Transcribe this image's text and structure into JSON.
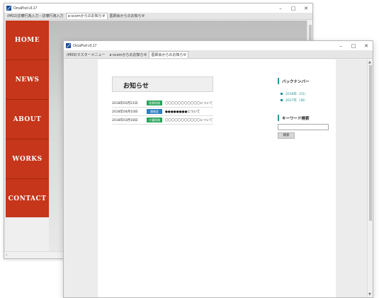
{
  "back_window": {
    "title": "OrcaPod v3.17",
    "controls": [
      "–",
      "□",
      "✕"
    ],
    "tabs": [
      {
        "label": "(M02)診療行為入力－診療行為入力",
        "active": false
      },
      {
        "label": "a-scomからのお知らせ",
        "active": true
      },
      {
        "label": "医師会からのお知らせ",
        "active": false
      }
    ],
    "nav_items": [
      "HOME",
      "NEWS",
      "ABOUT",
      "WORKS",
      "CONTACT"
    ],
    "colors": {
      "nav": "#c6361a"
    }
  },
  "front_window": {
    "title": "OrcaPod v3.17",
    "controls": [
      "–",
      "□",
      "✕"
    ],
    "tabs": [
      {
        "label": "(M00)マスターメニュー",
        "active": false
      },
      {
        "label": "a-scomからのお知らせ",
        "active": false
      },
      {
        "label": "医師会からのお知らせ",
        "active": true
      }
    ],
    "heading": "お知らせ",
    "news": [
      {
        "date": "2018年05月21日",
        "category": "医療保険",
        "category_color": "#27a35a",
        "text": "〇〇〇〇〇〇〇〇〇〇〇について",
        "dark": false
      },
      {
        "date": "2018年04月10日",
        "category": "連絡会",
        "category_color": "#2f7fc1",
        "text": "●●●●●●●●について",
        "dark": true
      },
      {
        "date": "2018年03月18日",
        "category": "介護保険",
        "category_color": "#27a35a",
        "text": "〇〇〇〇〇〇〇〇〇〇〇について",
        "dark": false
      }
    ],
    "sidebar": {
      "backnumber_title": "バックナンバー",
      "archives": [
        "2018年（15）",
        "2017年（36）"
      ],
      "keyword_title": "キーワード検索",
      "search_placeholder": "",
      "search_button": "検索"
    },
    "colors": {
      "accent": "#1b8f8f"
    }
  }
}
